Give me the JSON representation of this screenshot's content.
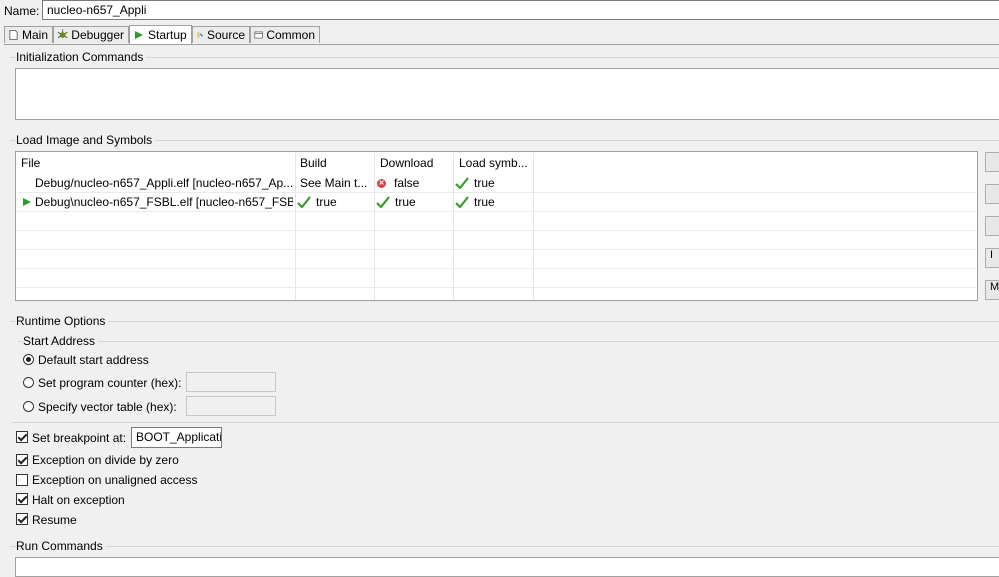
{
  "name_label": "Name:",
  "name_value": "nucleo-n657_Appli",
  "tabs": [
    {
      "label": "Main",
      "icon": "page-icon"
    },
    {
      "label": "Debugger",
      "icon": "bug-icon"
    },
    {
      "label": "Startup",
      "icon": "play-icon"
    },
    {
      "label": "Source",
      "icon": "source-icon"
    },
    {
      "label": "Common",
      "icon": "common-icon"
    }
  ],
  "active_tab": "Startup",
  "init_commands": {
    "title": "Initialization Commands"
  },
  "load_image": {
    "title": "Load Image and Symbols",
    "columns": [
      "File",
      "Build",
      "Download",
      "Load symb..."
    ],
    "rows": [
      {
        "file": "Debug/nucleo-n657_Appli.elf [nucleo-n657_Ap...",
        "build": "See Main t...",
        "download": "false",
        "symbols": "true",
        "download_icon": "error-icon",
        "symbols_icon": "check-icon",
        "marker": false
      },
      {
        "file": "Debug\\nucleo-n657_FSBL.elf [nucleo-n657_FSB...",
        "build": "true",
        "download": "true",
        "symbols": "true",
        "build_icon": "check-icon",
        "download_icon": "check-icon",
        "symbols_icon": "check-icon",
        "marker": true
      }
    ],
    "side_buttons": [
      "",
      "",
      "",
      "I",
      "M"
    ]
  },
  "runtime": {
    "title": "Runtime Options",
    "start_address_title": "Start Address",
    "default_start": "Default start address",
    "set_pc": "Set program counter (hex):",
    "vector_table": "Specify vector table (hex):",
    "selected": "default_start",
    "set_breakpoint": {
      "label": "Set breakpoint at:",
      "checked": true,
      "value": "BOOT_Applicati"
    },
    "exception_divide": {
      "label": "Exception on divide by zero",
      "checked": true
    },
    "exception_unaligned": {
      "label": "Exception on unaligned access",
      "checked": false
    },
    "halt_exception": {
      "label": "Halt on exception",
      "checked": true
    },
    "resume": {
      "label": "Resume",
      "checked": true
    }
  },
  "run_commands": {
    "title": "Run Commands"
  },
  "colors": {
    "check": "#3a9a2e",
    "error": "#d9414b",
    "play": "#2e9a2e"
  }
}
